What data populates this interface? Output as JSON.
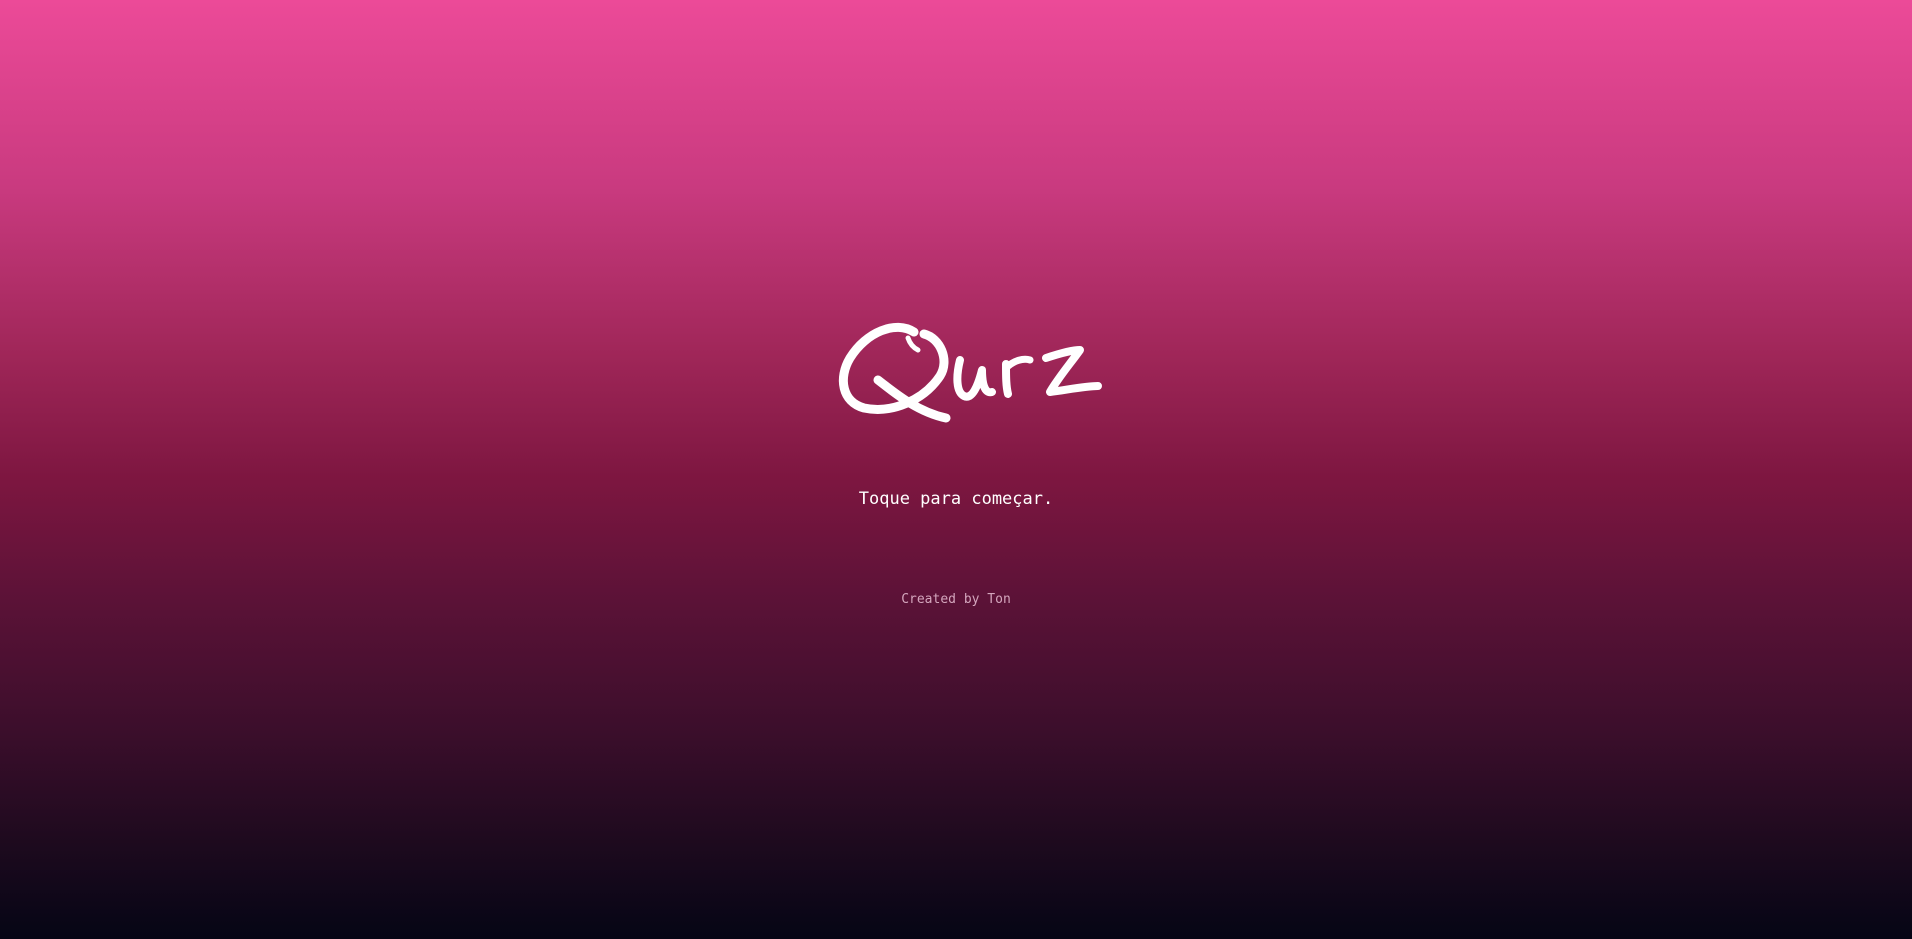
{
  "app": {
    "logo_text": "Quiz"
  },
  "start": {
    "label": "Toque para começar."
  },
  "footer": {
    "credit": "Created by Ton"
  },
  "colors": {
    "gradient_top": "#ec4a98",
    "gradient_middle": "#7d1640",
    "gradient_bottom": "#050515",
    "text": "#ffffff",
    "credit_text": "#d4a6bd"
  }
}
